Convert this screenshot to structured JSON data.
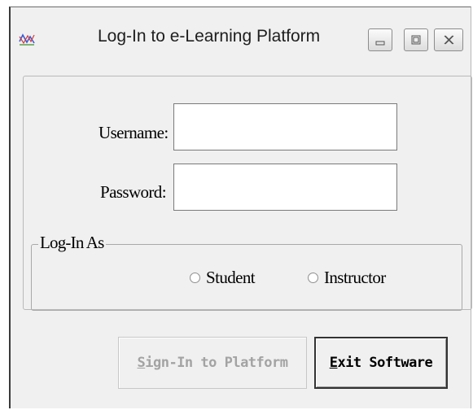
{
  "window": {
    "title": "Log-In to e-Learning Platform",
    "icon": "chart-app-icon",
    "controls": [
      "minimize",
      "maximize",
      "close"
    ]
  },
  "form": {
    "username_label": "Username:",
    "username_value": "",
    "password_label": "Password:",
    "password_value": ""
  },
  "login_as": {
    "legend": "Log-In As",
    "options": [
      {
        "label": "Student",
        "selected": false
      },
      {
        "label": "Instructor",
        "selected": false
      }
    ]
  },
  "buttons": {
    "sign_in": {
      "mnemonic": "S",
      "rest": "ign-In to Platform",
      "enabled": false
    },
    "exit": {
      "mnemonic": "E",
      "rest": "xit Software",
      "enabled": true
    }
  },
  "colors": {
    "window_bg": "#f0f0f0",
    "disabled_text": "#a3a3a3"
  }
}
